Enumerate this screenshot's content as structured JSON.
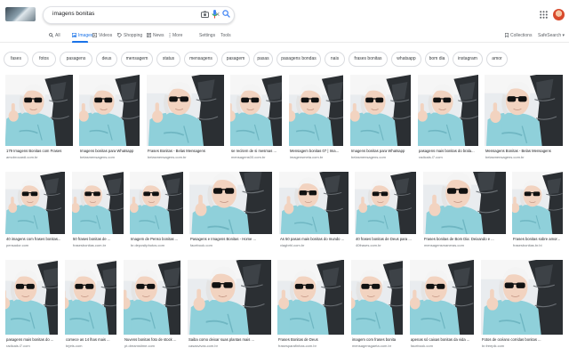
{
  "search": {
    "query": "imagens bonitas",
    "clear": "×"
  },
  "tabs": [
    {
      "label": "All",
      "icon": "search-icon",
      "active": false
    },
    {
      "label": "Images",
      "icon": "image-icon",
      "active": true
    },
    {
      "label": "Videos",
      "icon": "video-icon",
      "active": false
    },
    {
      "label": "Shopping",
      "icon": "tag-icon",
      "active": false
    },
    {
      "label": "News",
      "icon": "news-icon",
      "active": false
    },
    {
      "label": "More",
      "icon": "more-icon",
      "active": false
    }
  ],
  "tools": {
    "settings": "Settings",
    "tools": "Tools",
    "collections": "Collections",
    "safesearch": "SafeSearch ▾"
  },
  "chips": [
    "fases",
    "fotos",
    "pasagens",
    "deus",
    "mensagem",
    "status",
    "mensagens",
    "pasagem",
    "pasas",
    "pasagens bondas",
    "nais",
    "frases bonitas",
    "whatsapp",
    "bom dia",
    "instagram",
    "amor"
  ],
  "results": [
    {
      "caption": "179 Imagens Bonitas com Frases",
      "source": "amobrocardi.com.br"
    },
    {
      "caption": "Imagens bonitas para Whatsapp",
      "source": "belasmensagens.com"
    },
    {
      "caption": "Frases Bonitas - Belas Mensagens",
      "source": "belasmensagens.com.br"
    },
    {
      "caption": "se recitem de si mesmas ...",
      "source": "mensagens00.com.br"
    },
    {
      "caption": "Mensagem bonitas 07 | Ima...",
      "source": "imagensmeta.com.br"
    },
    {
      "caption": "Imagens bonitas para Whatsapp",
      "source": "belasmensagens.com"
    },
    {
      "caption": "pasagens mais bonitas do brala...",
      "source": "radicais.l7.com"
    },
    {
      "caption": "Mensagens Bonitas - Belas Mensagens",
      "source": "belasmensagens.com.br"
    },
    {
      "caption": "40 imagens com frases bonitas...",
      "source": "pensador.com"
    },
    {
      "caption": "50 frases bonitas de ...",
      "source": "frasesbonitas.com.br"
    },
    {
      "caption": "Imagem de Penso bonitas ...",
      "source": "br.depositphotos.com"
    },
    {
      "caption": "Pasagens e Imagens Bonitas - Home ...",
      "source": "facebook.com"
    },
    {
      "caption": "As 50 pasas mais bonitas do mundo ...",
      "source": "viagbrhl.com.br"
    },
    {
      "caption": "40 frases bonitas de Deus para ...",
      "source": "40frases.com.br"
    },
    {
      "caption": "Frases bonitas de Bom Dia: Deixando e ...",
      "source": "mensagensmaneras.com"
    },
    {
      "caption": "Frases bonitas sobre amor...",
      "source": "frasesbonitas.br.bi"
    },
    {
      "caption": "pasagens mais bonitas do ...",
      "source": "radicais.l7.com"
    },
    {
      "caption": "comece as 14 lhas mais ...",
      "source": "brjets.com"
    },
    {
      "caption": "Nuvens bonitas foto de stock ...",
      "source": "pt.dreamstime.com"
    },
    {
      "caption": "Saiba como deixar suas plantas mais ...",
      "source": "casasvivas.com.br"
    },
    {
      "caption": "Frases Bonitas de Deus",
      "source": "frasesparafinhas.com.br"
    },
    {
      "caption": "imagem com frases bonita",
      "source": "mensagensgaeta.com.br"
    },
    {
      "caption": "apenas só caixas bonitas da vida ...",
      "source": "facebook.com"
    },
    {
      "caption": "Fotos de océano corridas bonitas ...",
      "source": "br.freepik.com"
    }
  ],
  "colors": {
    "accent": "#1a73e8",
    "shirt": "#8fd0da",
    "background": "#ffffff"
  }
}
